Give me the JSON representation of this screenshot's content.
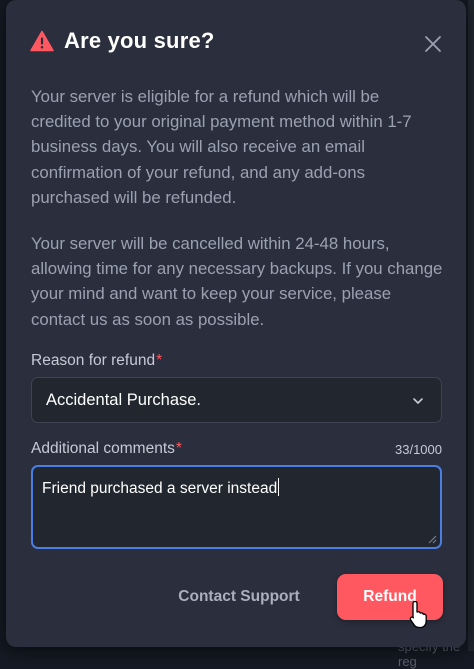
{
  "backdrop": {
    "bottom_text": "specify the reg"
  },
  "dialog": {
    "title": "Are you sure?",
    "paragraph_1": "Your server is eligible for a refund which will be credited to your original payment method within 1-7 business days. You will also receive an email confirmation of your refund, and any add-ons purchased will be refunded.",
    "paragraph_2": "Your server will be cancelled within 24-48 hours, allowing time for any necessary backups. If you change your mind and want to keep your service, please contact us as soon as possible.",
    "reason": {
      "label": "Reason for refund",
      "required_mark": "*",
      "selected": "Accidental Purchase."
    },
    "comments": {
      "label": "Additional comments",
      "required_mark": "*",
      "counter": "33/1000",
      "value": "Friend purchased a server instead"
    },
    "contact_label": "Contact Support",
    "refund_label": "Refund"
  },
  "colors": {
    "modal_bg": "#2b2f3d",
    "accent_danger": "#ff5861",
    "focus_border": "#4a7ee3",
    "required": "#ff5661"
  },
  "icons": {
    "title_icon": "warning-icon",
    "close": "close-icon",
    "select": "chevron-down-icon"
  }
}
